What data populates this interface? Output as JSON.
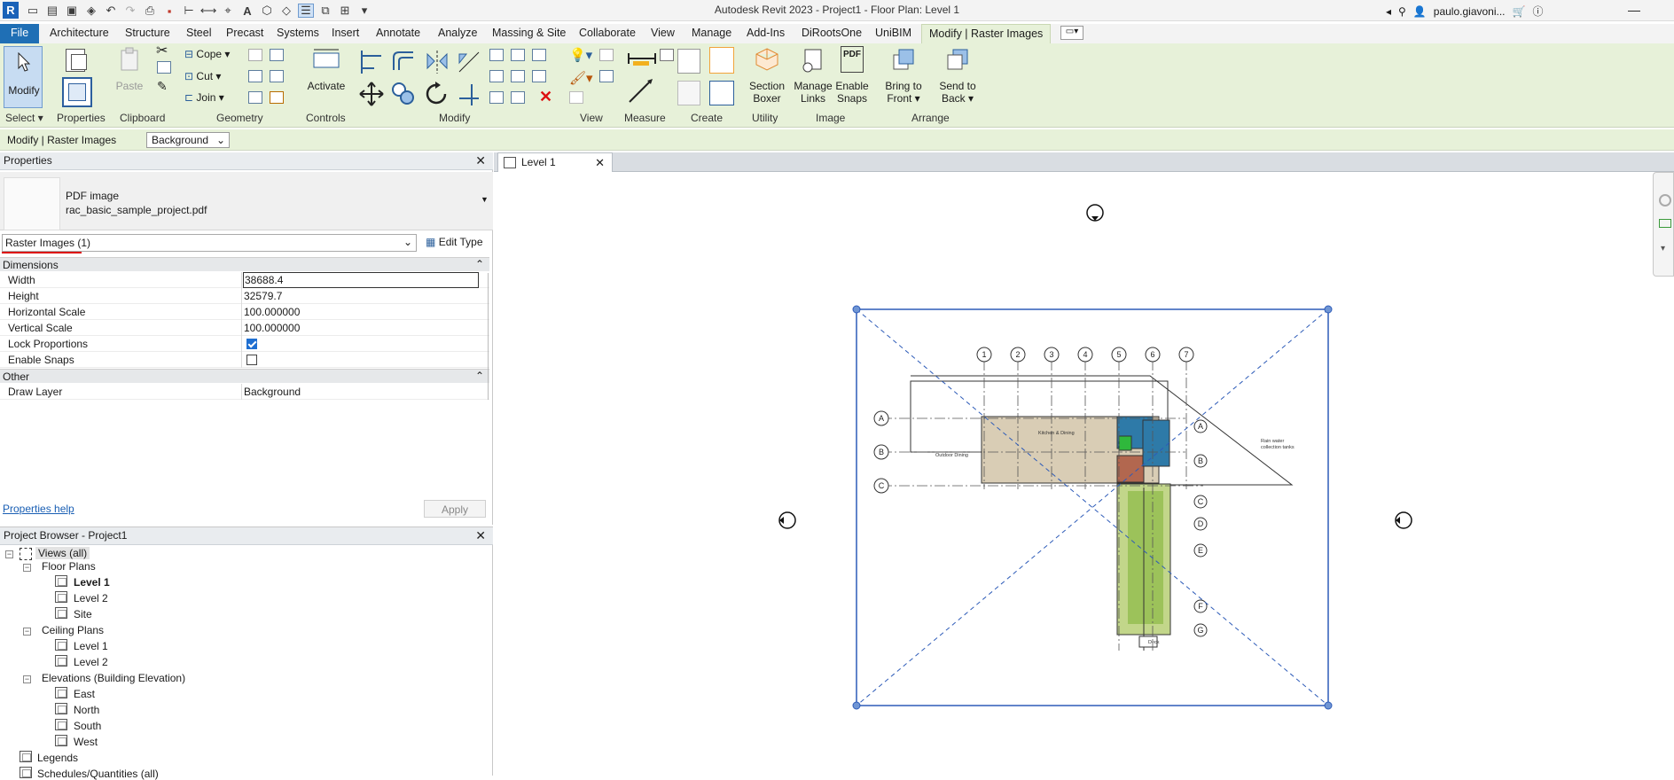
{
  "title": "Autodesk Revit 2023 - Project1 - Floor Plan: Level 1",
  "user": "paulo.giavoni...",
  "tabs": [
    "File",
    "Architecture",
    "Structure",
    "Steel",
    "Precast",
    "Systems",
    "Insert",
    "Annotate",
    "Analyze",
    "Massing & Site",
    "Collaborate",
    "View",
    "Manage",
    "Add-Ins",
    "DiRootsOne",
    "UniBIM",
    "Modify | Raster Images"
  ],
  "ribbon": {
    "modify": "Modify",
    "paste": "Paste",
    "cope": "Cope",
    "cut": "Cut",
    "join": "Join",
    "activate": "Activate",
    "section_boxer_1": "Section",
    "section_boxer_2": "Boxer",
    "manage_links_1": "Manage",
    "manage_links_2": "Links",
    "enable_snaps_1": "Enable",
    "enable_snaps_2": "Snaps",
    "bring_front_1": "Bring to",
    "bring_front_2": "Front",
    "send_back_1": "Send to",
    "send_back_2": "Back",
    "pdf": "PDF",
    "panels": [
      "Select",
      "Properties",
      "Clipboard",
      "Geometry",
      "Controls",
      "Modify",
      "View",
      "Measure",
      "Create",
      "Utility",
      "Image",
      "Arrange"
    ]
  },
  "optbar": {
    "context": "Modify | Raster Images",
    "layer": "Background"
  },
  "properties": {
    "header": "Properties",
    "type_line1": "PDF image",
    "type_line2": "rac_basic_sample_project.pdf",
    "selector": "Raster Images (1)",
    "edit_type": "Edit Type",
    "group_dimensions": "Dimensions",
    "rows": [
      {
        "k": "Width",
        "v": "38688.4"
      },
      {
        "k": "Height",
        "v": "32579.7"
      },
      {
        "k": "Horizontal Scale",
        "v": "100.000000"
      },
      {
        "k": "Vertical Scale",
        "v": "100.000000"
      },
      {
        "k": "Lock Proportions",
        "v": "true"
      },
      {
        "k": "Enable Snaps",
        "v": "false"
      }
    ],
    "group_other": "Other",
    "draw_layer_k": "Draw Layer",
    "draw_layer_v": "Background",
    "help": "Properties help",
    "apply": "Apply"
  },
  "browser": {
    "header": "Project Browser - Project1",
    "views_all": "Views (all)",
    "floor_plans": "Floor Plans",
    "fp": [
      "Level 1",
      "Level 2",
      "Site"
    ],
    "ceiling_plans": "Ceiling Plans",
    "cp": [
      "Level 1",
      "Level 2"
    ],
    "elevations": "Elevations (Building Elevation)",
    "el": [
      "East",
      "North",
      "South",
      "West"
    ],
    "legends": "Legends",
    "schedules": "Schedules/Quantities (all)"
  },
  "view": {
    "tab": "Level 1",
    "grid_numbers": [
      "1",
      "2",
      "3",
      "4",
      "5",
      "6",
      "7"
    ],
    "grid_letters_left": [
      "A",
      "B",
      "C"
    ],
    "grid_letters_right": [
      "A",
      "B",
      "C",
      "D",
      "E",
      "F",
      "G"
    ],
    "labels": {
      "outdoor": "Outdoor Dining",
      "kitchen": "Kitchen & Dining",
      "rain1": "Rain water",
      "rain2": "collection tanks",
      "deck": "Deck"
    }
  },
  "colors": {
    "accent": "#1f6fb5",
    "ribbon_bg": "#e7f1d9",
    "selection": "#2d5bb8"
  }
}
